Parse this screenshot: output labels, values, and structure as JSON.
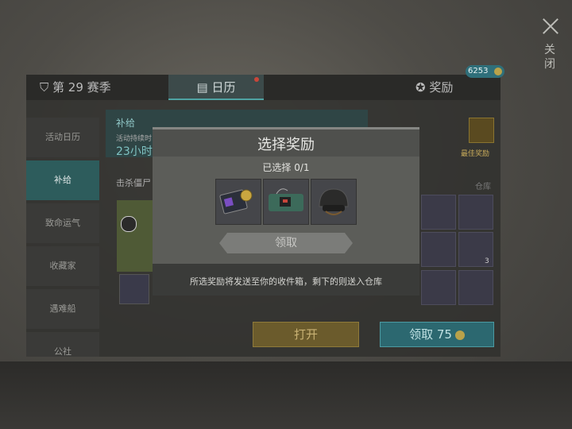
{
  "close": {
    "label": "关闭"
  },
  "tabs": [
    {
      "label": "第 29 赛季"
    },
    {
      "label": "日历"
    },
    {
      "label": "奖励"
    }
  ],
  "currency": {
    "amount": "6253"
  },
  "sidebar": {
    "items": [
      {
        "label": "活动日历"
      },
      {
        "label": "补给"
      },
      {
        "label": "致命运气"
      },
      {
        "label": "收藏家"
      },
      {
        "label": "遇难船"
      },
      {
        "label": "公社"
      }
    ]
  },
  "content": {
    "title": "补给",
    "subtitle": "活动持续时",
    "timer": "23小时",
    "kill_text": "击杀僵尸",
    "open_button": "打开"
  },
  "right": {
    "best_reward": "最佳奖励",
    "storage": "仓库",
    "stack_count": "3",
    "claim_button": "领取 75"
  },
  "dialog": {
    "title": "选择奖励",
    "selected": "已选择 0/1",
    "items": [
      {
        "name": "id-card-badge-icon"
      },
      {
        "name": "explosive-bundle-icon"
      },
      {
        "name": "helmet-icon"
      }
    ],
    "claim_button": "领取",
    "notice": "所选奖励将发送至你的收件箱，剩下的则送入仓库"
  },
  "colors": {
    "accent": "#4fa3a3",
    "gold": "#c9b274"
  }
}
